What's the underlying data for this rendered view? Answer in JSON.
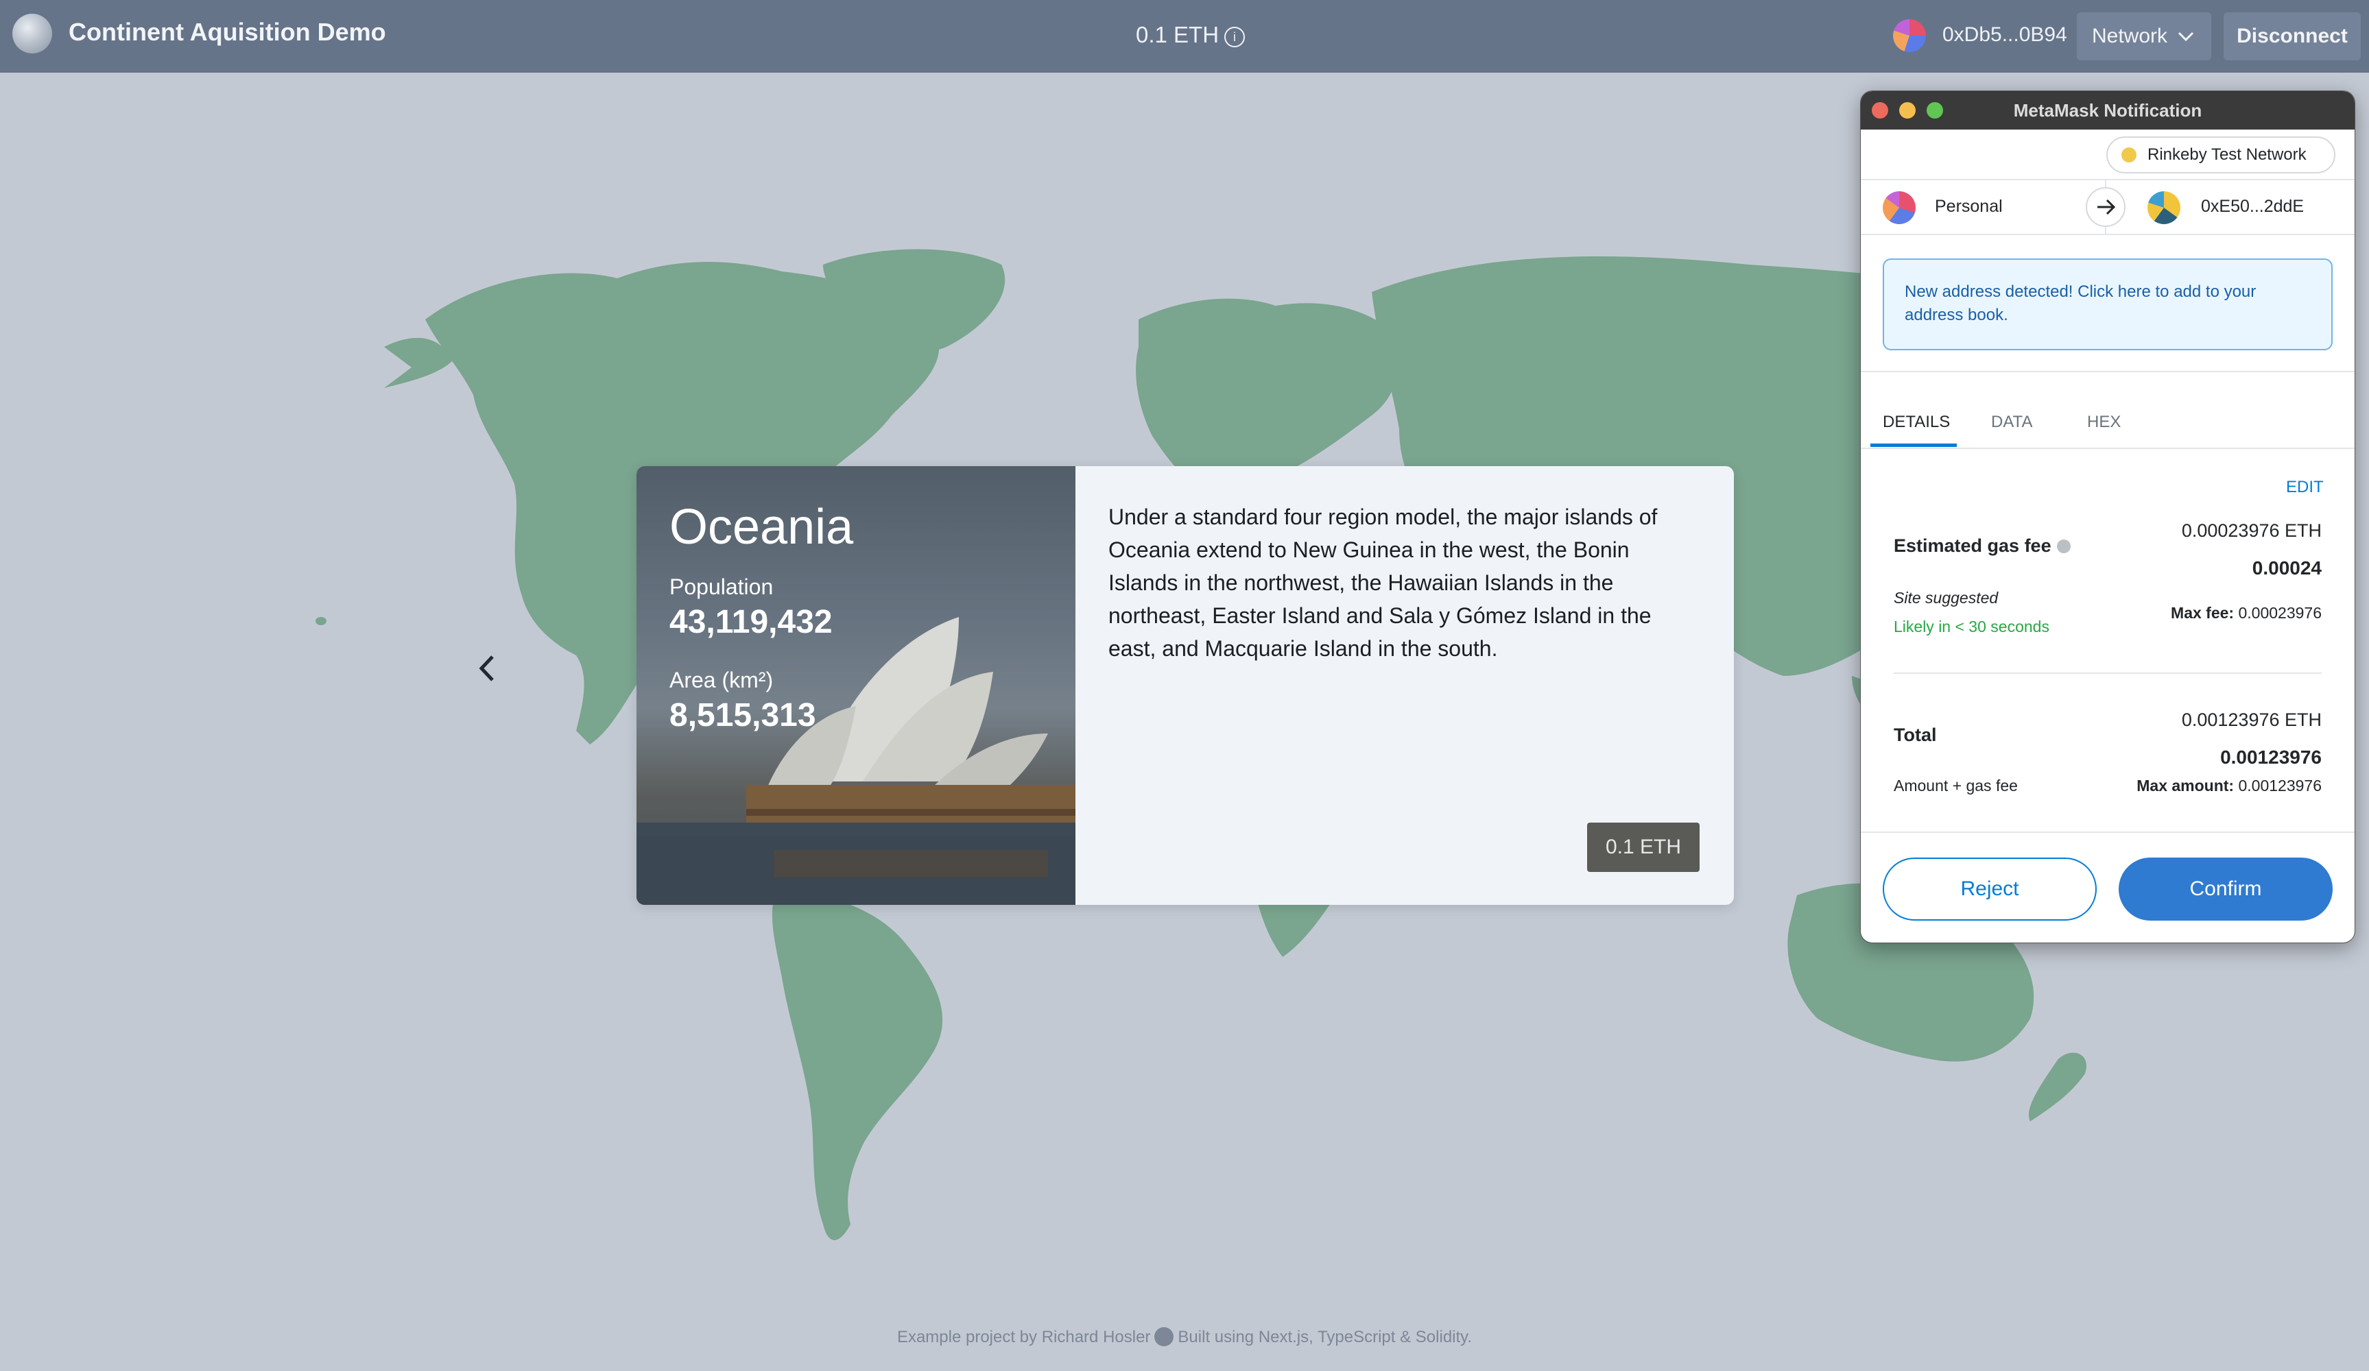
{
  "header": {
    "app_title": "Continent Aquisition Demo",
    "price": "0.1 ETH",
    "account_address": "0xDb5...0B94",
    "network_label": "Network",
    "disconnect_label": "Disconnect"
  },
  "card": {
    "continent": "Oceania",
    "population_label": "Population",
    "population_value": "43,119,432",
    "area_label": "Area (km²)",
    "area_value": "8,515,313",
    "description": "Under a standard four region model, the major islands of Oceania extend to New Guinea in the west, the Bonin Islands in the northwest, the Hawaiian Islands in the northeast, Easter Island and Sala y Gómez Island in the east, and Macquarie Island in the south.",
    "buy_label": "0.1 ETH"
  },
  "footer": {
    "credit": "Example project by Richard Hosler",
    "built_with": "Built using Next.js, TypeScript & Solidity."
  },
  "metamask": {
    "window_title": "MetaMask Notification",
    "network": "Rinkeby Test Network",
    "from_account": "Personal",
    "to_address": "0xE50...2ddE",
    "alert": "New address detected! Click here to add to your address book.",
    "tabs": [
      "DETAILS",
      "DATA",
      "HEX"
    ],
    "active_tab": "DETAILS",
    "edit_label": "EDIT",
    "gas_fee_label": "Estimated gas fee",
    "gas_fee_eth": "0.00023976 ETH",
    "gas_fee_short": "0.00024",
    "site_suggested": "Site suggested",
    "likely_time": "Likely in < 30 seconds",
    "max_fee_label": "Max fee:",
    "max_fee_value": "0.00023976",
    "total_label": "Total",
    "total_eth": "0.00123976 ETH",
    "total_short": "0.00123976",
    "amount_gas_label": "Amount + gas fee",
    "max_amount_label": "Max amount:",
    "max_amount_value": "0.00123976",
    "reject_label": "Reject",
    "confirm_label": "Confirm"
  },
  "colors": {
    "topbar": "#66748a",
    "background": "#c3c9d3",
    "land": "#7aa58f",
    "metamask_blue": "#037dd6"
  },
  "icons": {
    "info": "info-icon",
    "chevron": "chevron-down-icon",
    "prev": "chevron-left-icon",
    "github": "github-icon",
    "arrow": "arrow-right-icon"
  }
}
